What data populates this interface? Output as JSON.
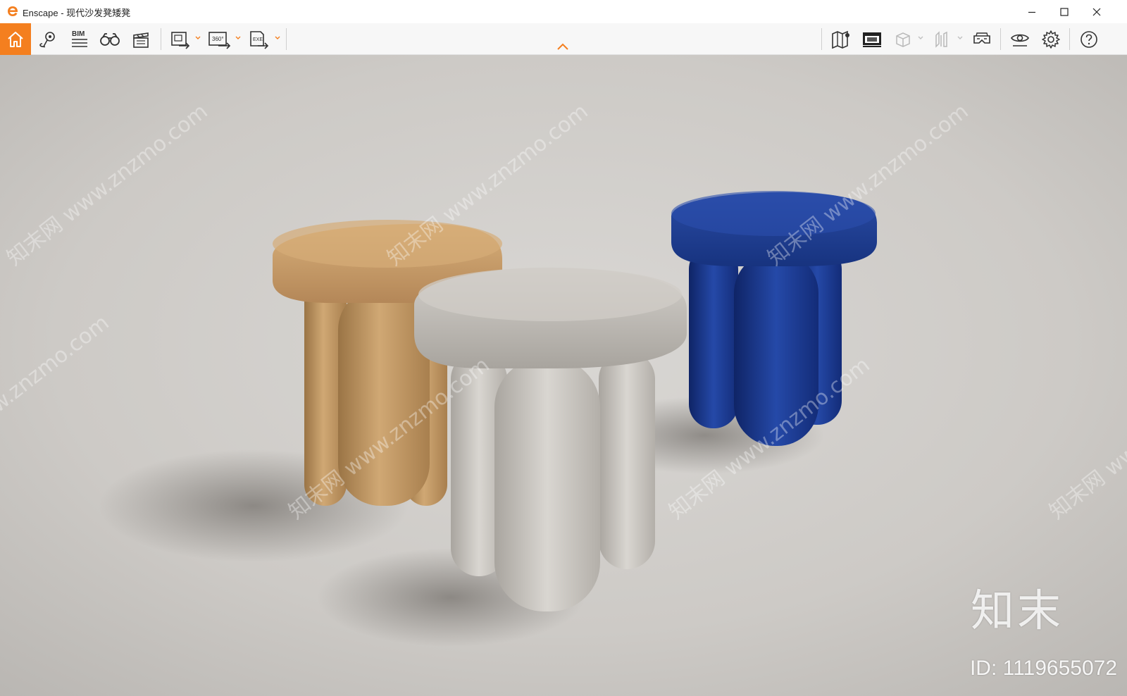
{
  "window": {
    "app_name": "Enscape",
    "title": "Enscape - 现代沙发凳矮凳",
    "brand_color": "#f47f1f"
  },
  "toolbar": {
    "left_tools": [
      {
        "name": "home",
        "icon": "home-icon",
        "active": true
      },
      {
        "name": "views",
        "icon": "location-pin-icon"
      },
      {
        "name": "bim",
        "icon": "bim-icon",
        "label": "BIM"
      },
      {
        "name": "vr-headset",
        "icon": "binoculars-icon"
      },
      {
        "name": "video-editor",
        "icon": "clapperboard-icon"
      },
      {
        "name": "export-image",
        "icon": "export-image-icon"
      },
      {
        "name": "export-panorama",
        "icon": "export-panorama-icon",
        "label": "360°"
      },
      {
        "name": "export-exe",
        "icon": "export-exe-icon",
        "label": "EXE"
      }
    ],
    "right_tools": [
      {
        "name": "map",
        "icon": "map-icon"
      },
      {
        "name": "screen",
        "icon": "monitor-icon"
      },
      {
        "name": "cube-view",
        "icon": "cube-icon"
      },
      {
        "name": "section",
        "icon": "section-icon"
      },
      {
        "name": "vr",
        "icon": "vr-goggles-icon"
      },
      {
        "name": "visual-settings",
        "icon": "eye-icon"
      },
      {
        "name": "settings",
        "icon": "gear-icon"
      },
      {
        "name": "help",
        "icon": "help-icon"
      }
    ]
  },
  "viewport": {
    "description_colors": {
      "background": "#c9c6c2",
      "stool_tan": "#c9a06c",
      "stool_grey": "#bdb9b3",
      "stool_blue": "#1c3a8a"
    },
    "watermark_site": "知末网 www.znzmo.com",
    "brand_watermark": "知末",
    "id_watermark": "ID: 1119655072"
  }
}
